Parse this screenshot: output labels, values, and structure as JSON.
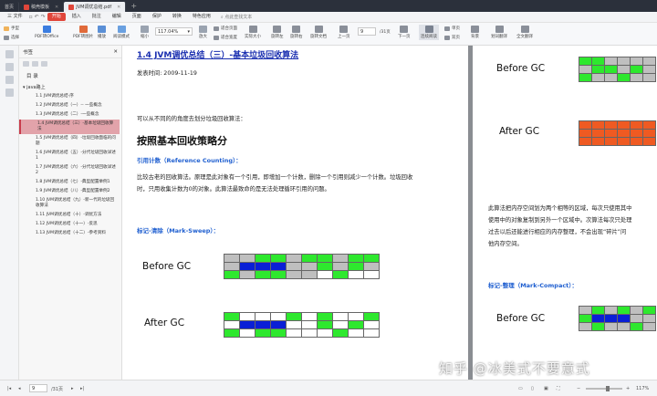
{
  "tabs": [
    {
      "label": "首页",
      "active": false
    },
    {
      "label": "稿壳模板",
      "active": false
    },
    {
      "label": "JVM调优总结.pdf",
      "active": true
    }
  ],
  "menu": {
    "items": [
      "三 文件",
      "开始",
      "插入",
      "批注",
      "编辑",
      "页面",
      "保护",
      "转换",
      "特色应用"
    ],
    "active_index": 1,
    "search": "点此查找文本"
  },
  "toolbar": {
    "hand": "手型",
    "select": "选择",
    "pdf_to_office": "PDF转Office",
    "pdf_to_image": "PDF转图片",
    "play": "播放",
    "read_mode": "阅读模式",
    "zoom_value": "117.04%",
    "zoom_in": "放大",
    "zoom_out": "缩小",
    "fit_page": "适合页面",
    "fit_width": "适合宽度",
    "actual_size": "实际大小",
    "rotate_left": "旋转左",
    "rotate_right": "旋转右",
    "rotate_doc": "旋转文档",
    "prev_page": "上一页",
    "next_page": "下一页",
    "page_current": "9",
    "page_total": "/31页",
    "continuous": "连续阅读",
    "single": "单页",
    "double": "双页",
    "background": "背景",
    "full_translate": "全文翻译",
    "split_translate": "划词翻译"
  },
  "sidebar": {
    "title": "书签",
    "toc_title": "目 录",
    "root": "java路上",
    "items": [
      {
        "label": "1.1 JVM调优总结-序",
        "sel": false
      },
      {
        "label": "1.2 JVM调优总结（一）-- 一些概念",
        "sel": false
      },
      {
        "label": "1.3 JVM调优总结（二）-一些概念",
        "sel": false
      },
      {
        "label": "1.4 JVM调优总结（三）-基本垃圾回收算法",
        "sel": true
      },
      {
        "label": "1.5 JVM调优总结（四）-垃圾回收面临的问题",
        "sel": false
      },
      {
        "label": "1.6 JVM调优总结（五）-分代垃圾回收详述1",
        "sel": false
      },
      {
        "label": "1.7 JVM调优总结（六）-分代垃圾回收详述2",
        "sel": false
      },
      {
        "label": "1.8 JVM调优总结（七）-典型配置举例1",
        "sel": false
      },
      {
        "label": "1.9 JVM调优总结（八）-典型配置举例2",
        "sel": false
      },
      {
        "label": "1.10 JVM调优总结（九）-新一代的垃圾回收算法",
        "sel": false
      },
      {
        "label": "1.11 JVM调优总结（十）-调优方法",
        "sel": false
      },
      {
        "label": "1.12 JVM调优总结（十一）-反思",
        "sel": false
      },
      {
        "label": "1.13 JVM调优总结（十二）-参考资料",
        "sel": false
      }
    ]
  },
  "page1": {
    "title": "1.4 JVM调优总结（三）-基本垃圾回收算法",
    "date": "发表时间: 2009-11-19",
    "intro": "可以从不同的的角度去划分垃圾回收算法：",
    "heading": "按照基本回收策略分",
    "ref_counting": "引用计数（Reference Counting）：",
    "ref_text1": "比较古老的回收算法。原理是此对象有一个引用，即增加一个计数，删除一个引用则减少一个计数。垃圾回收",
    "ref_text2": "时，只用收集计数为0的对象。此算法最致命的是无法处理循环引用的问题。",
    "mark_sweep": "标记-清除（Mark-Sweep）：",
    "before": "Before GC",
    "after": "After GC"
  },
  "page2": {
    "before": "Before GC",
    "after": "After GC",
    "copy_text": [
      "此算法把内存空间划为两个相等的区域，每次只使用其中",
      "使用中的对象复制到另外一个区域中。次算法每次只处理",
      "过去以后还能进行相应的内存整理，不会出现“碎片”问",
      "他内存空间。"
    ],
    "mark_compact": "标记-整理（Mark-Compact）：",
    "before2": "Before GC"
  },
  "watermark": "知乎 @冰美式不要意式",
  "status": {
    "page_current": "9",
    "page_total": "/31页",
    "zoom": "117%"
  },
  "colors": {
    "accent": "#e0463a",
    "link_blue": "#1a2fb0",
    "live": "#2ee82e",
    "ref": "#0a1fd6",
    "free": "#bfbfbf",
    "copied": "#ef5a22"
  }
}
